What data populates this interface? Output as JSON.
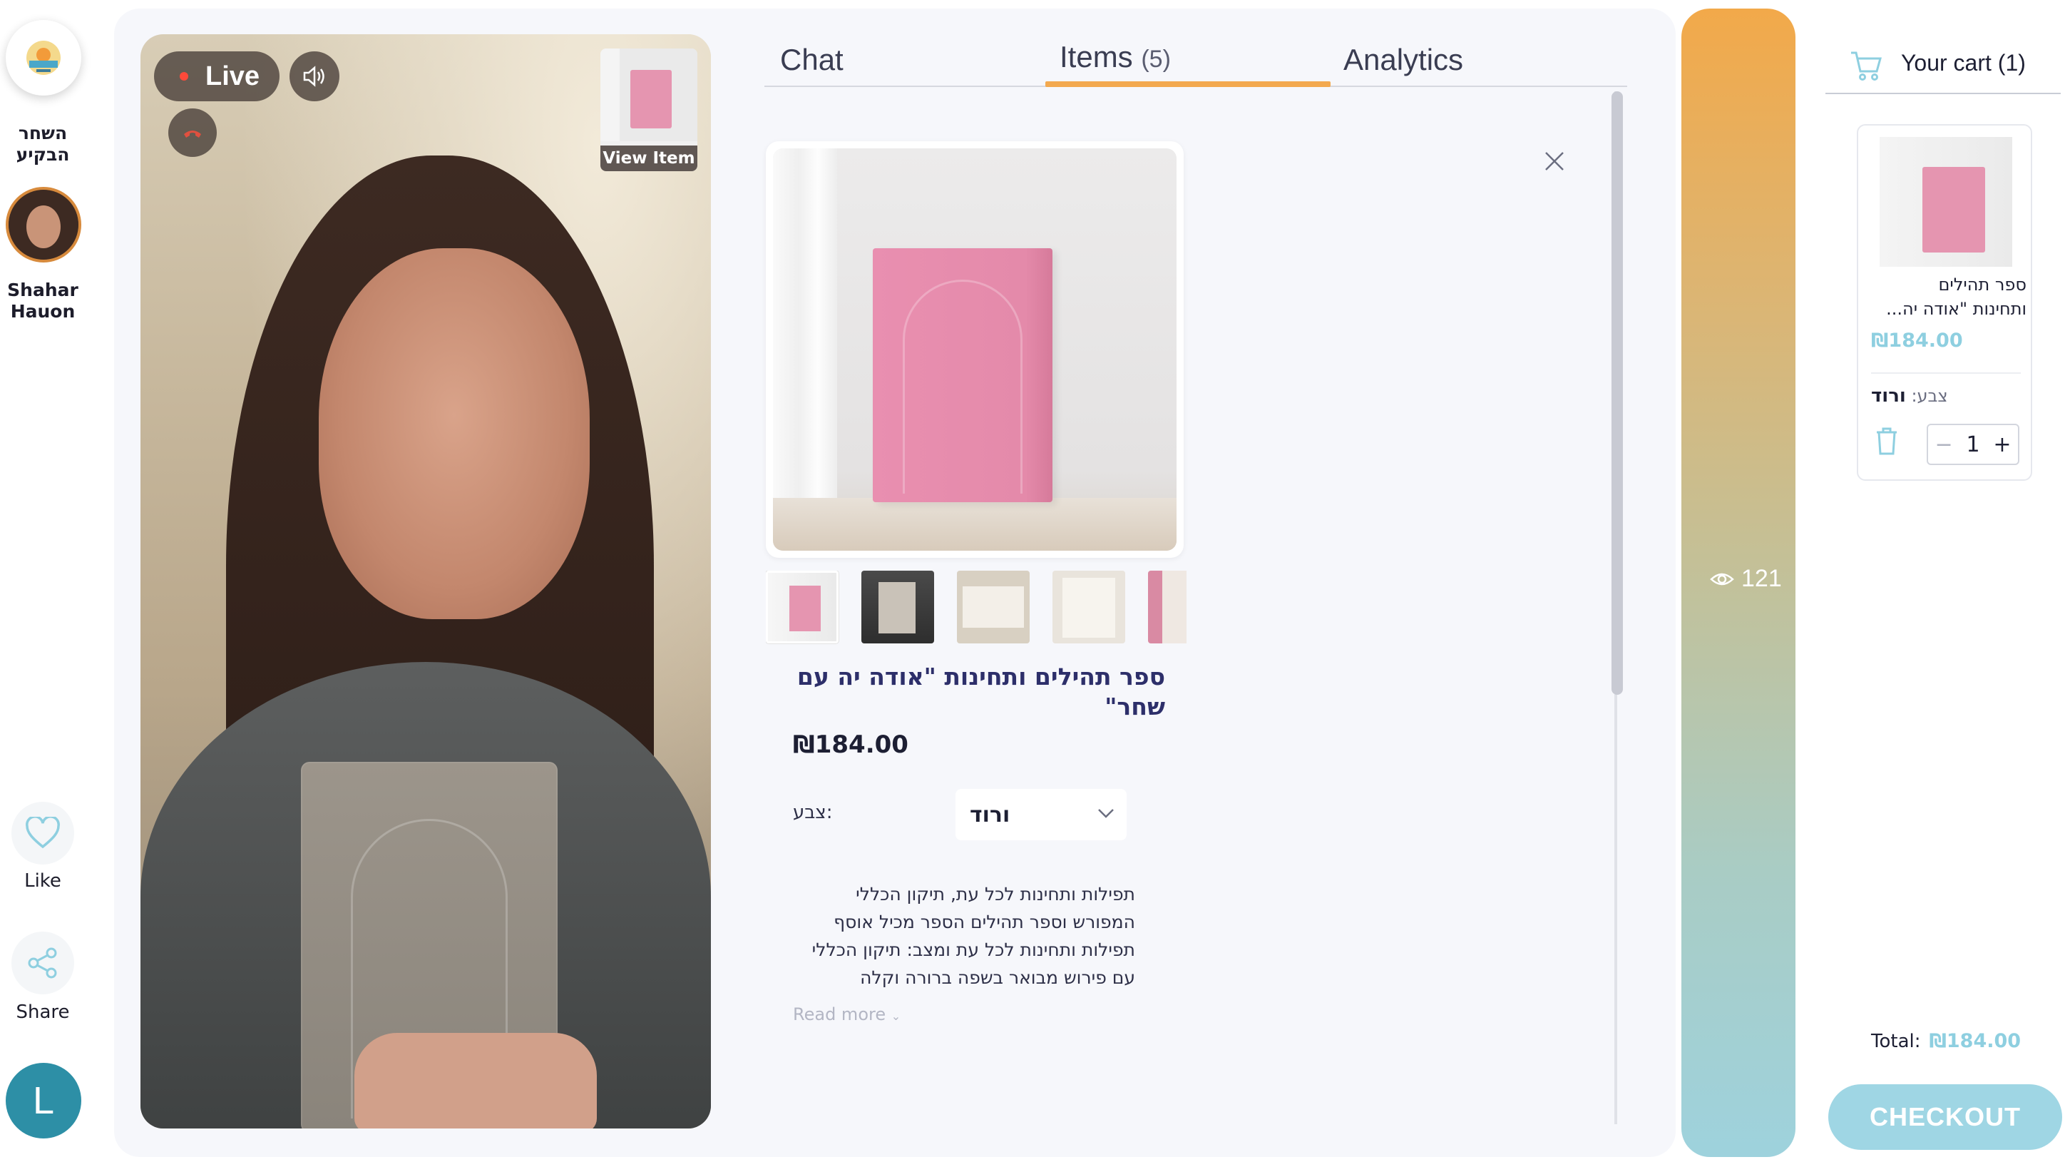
{
  "rail": {
    "shop_name": "השחר הבקיע",
    "host_name": "Shahar Hauon",
    "like_label": "Like",
    "share_label": "Share",
    "user_initial": "L"
  },
  "video": {
    "live_label": "Live",
    "view_item_label": "View Item"
  },
  "tabs": [
    {
      "label": "Chat"
    },
    {
      "label": "Items",
      "count": "(5)"
    },
    {
      "label": "Analytics"
    }
  ],
  "item": {
    "title": "ספר תהילים ותחינות \"אודה יה עם שחר\"",
    "price": "₪184.00",
    "color_label": "צבע:",
    "color_value": "ורוד",
    "description_lines": [
      "תפילות ותחינות לכל עת, תיקון הכללי",
      "המפורש וספר תהילים הספר מכיל אוסף",
      "תפילות ותחינות לכל עת ומצב: תיקון הכללי",
      "עם פירוש מבואר בשפה ברורה וקלה"
    ],
    "read_more": "Read more"
  },
  "viewers": {
    "count": "121"
  },
  "cart": {
    "title": "Your cart (1)",
    "item_name_line1": "ספר תהילים",
    "item_name_line2": "ותחינות \"אודה יה...",
    "item_price": "₪184.00",
    "variant_label": "צבע:",
    "variant_value": "ורוד",
    "quantity": "1",
    "total_label": "Total:",
    "total_value": "₪184.00",
    "checkout_label": "CHECKOUT"
  },
  "colors": {
    "accent_orange": "#f3a94f",
    "cart_price_blue": "#8ecfe0",
    "checkout_bg": "#9fd6e4",
    "title_navy": "#2d2f6a"
  }
}
